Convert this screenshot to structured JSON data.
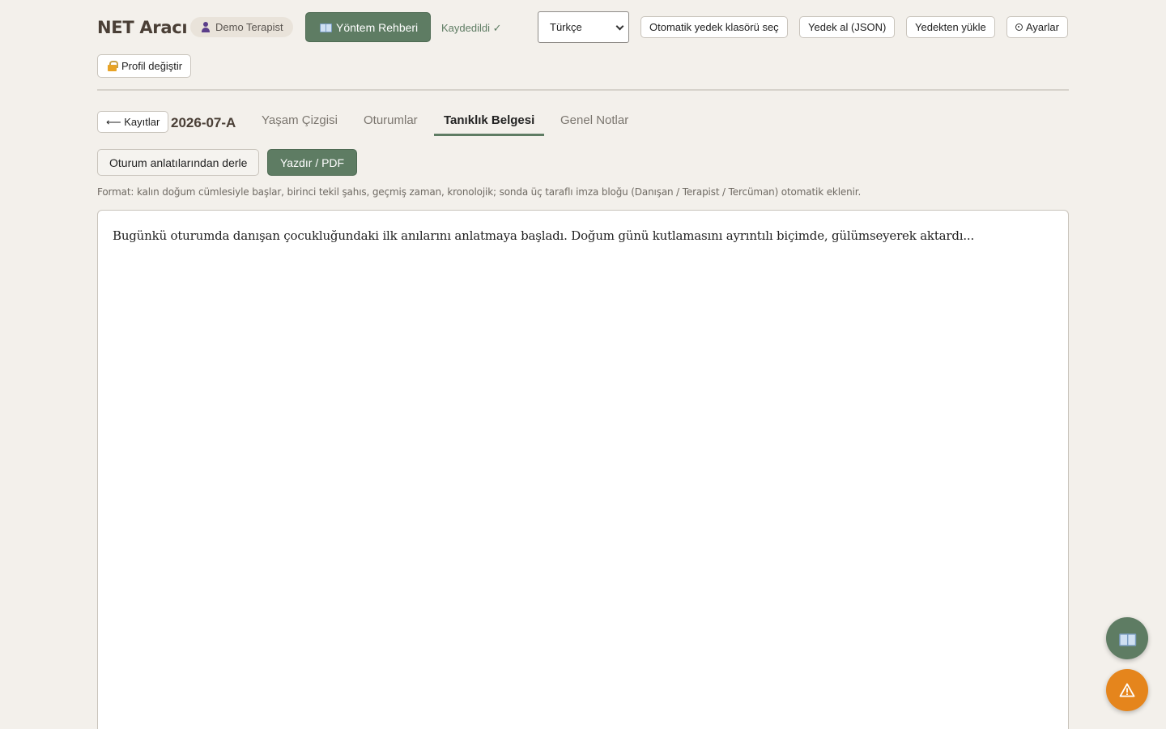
{
  "header": {
    "app_title": "NET Aracı",
    "user_name": "Demo Terapist",
    "method_guide_label": "Yöntem Rehberi",
    "saved_status": "Kaydedildi ✓",
    "language_selected": "Türkçe",
    "auto_backup_folder_label": "Otomatik yedek klasörü seç",
    "backup_json_label": "Yedek al (JSON)",
    "restore_label": "Yedekten yükle",
    "settings_label": "Ayarlar",
    "change_profile_label": "Profil değiştir"
  },
  "record": {
    "back_label": "⟵ Kayıtlar",
    "id": "2026-07-A",
    "tabs": [
      {
        "label": "Yaşam Çizgisi",
        "active": false
      },
      {
        "label": "Oturumlar",
        "active": false
      },
      {
        "label": "Tanıklık Belgesi",
        "active": true
      },
      {
        "label": "Genel Notlar",
        "active": false
      }
    ]
  },
  "testimony": {
    "compile_label": "Oturum anlatılarından derle",
    "print_label": "Yazdır / PDF",
    "format_note": "Format: kalın doğum cümlesiyle başlar, birinci tekil şahıs, geçmiş zaman, kronolojik; sonda üç taraflı imza bloğu (Danışan / Terapist / Tercüman) otomatik eklenir.",
    "text": "Bugünkü oturumda danışan çocukluğundaki ilk anılarını anlatmaya başladı. Doğum günü kutlamasını ayrıntılı biçimde, gülümseyerek aktardı..."
  },
  "colors": {
    "background": "#f3f0eb",
    "accent_green": "#5e7c63",
    "warning_orange": "#e5851c"
  },
  "icons": {
    "user": "person-icon",
    "guide": "book-icon",
    "settings": "gear-icon",
    "profile": "lock-icon",
    "select": "chevron-down-icon",
    "warning_fab": "warning-icon"
  }
}
